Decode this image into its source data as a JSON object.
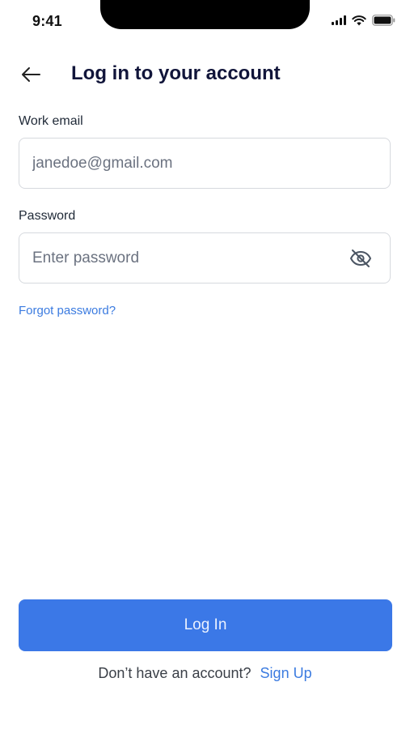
{
  "status_bar": {
    "time": "9:41",
    "icons": [
      "signal-icon",
      "wifi-icon",
      "battery-icon"
    ]
  },
  "header": {
    "back_icon": "arrow-left-icon",
    "title": "Log in to your account"
  },
  "form": {
    "email": {
      "label": "Work email",
      "value": "",
      "placeholder": "janedoe@gmail.com"
    },
    "password": {
      "label": "Password",
      "value": "",
      "placeholder": "Enter password",
      "toggle_icon": "eye-off-icon"
    },
    "forgot_password": "Forgot password?"
  },
  "actions": {
    "login_label": "Log In",
    "signup_prompt": "Don’t have an account?",
    "signup_label": "Sign Up"
  },
  "colors": {
    "primary": "#3b78e7",
    "link": "#3b7be0",
    "title": "#11153a",
    "border": "#d6d9de"
  }
}
